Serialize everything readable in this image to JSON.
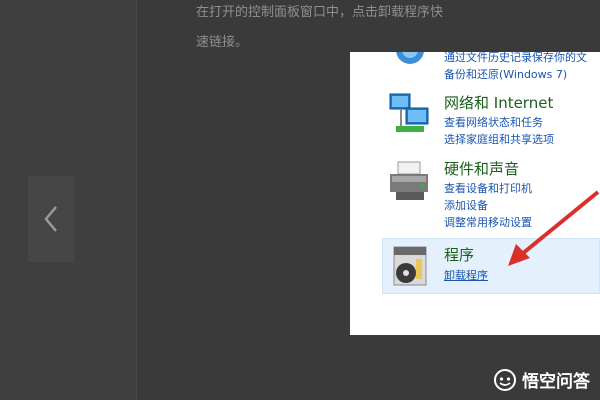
{
  "article": {
    "line1": "在打开的控制面板窗口中，点击卸载程序快",
    "line2": "速链接。"
  },
  "control_panel": {
    "backup_section": {
      "link1": "通过文件历史记录保存你的文",
      "link2": "备份和还原(Windows 7)"
    },
    "network": {
      "title": "网络和 Internet",
      "links": [
        "查看网络状态和任务",
        "选择家庭组和共享选项"
      ]
    },
    "hardware": {
      "title": "硬件和声音",
      "links": [
        "查看设备和打印机",
        "添加设备",
        "调整常用移动设置"
      ]
    },
    "programs": {
      "title": "程序",
      "links": [
        "卸载程序"
      ]
    }
  },
  "watermark": {
    "text": "悟空问答"
  },
  "colors": {
    "accent_arrow": "#d9302a",
    "link": "#1a55b0",
    "category_title": "#1a5f1a",
    "selected_bg": "#e4f0fb"
  },
  "icons": {
    "prev": "chevron-left-icon",
    "network": "network-monitors-icon",
    "hardware": "printer-icon",
    "programs": "program-disc-icon",
    "watermark": "wukong-logo-icon"
  }
}
